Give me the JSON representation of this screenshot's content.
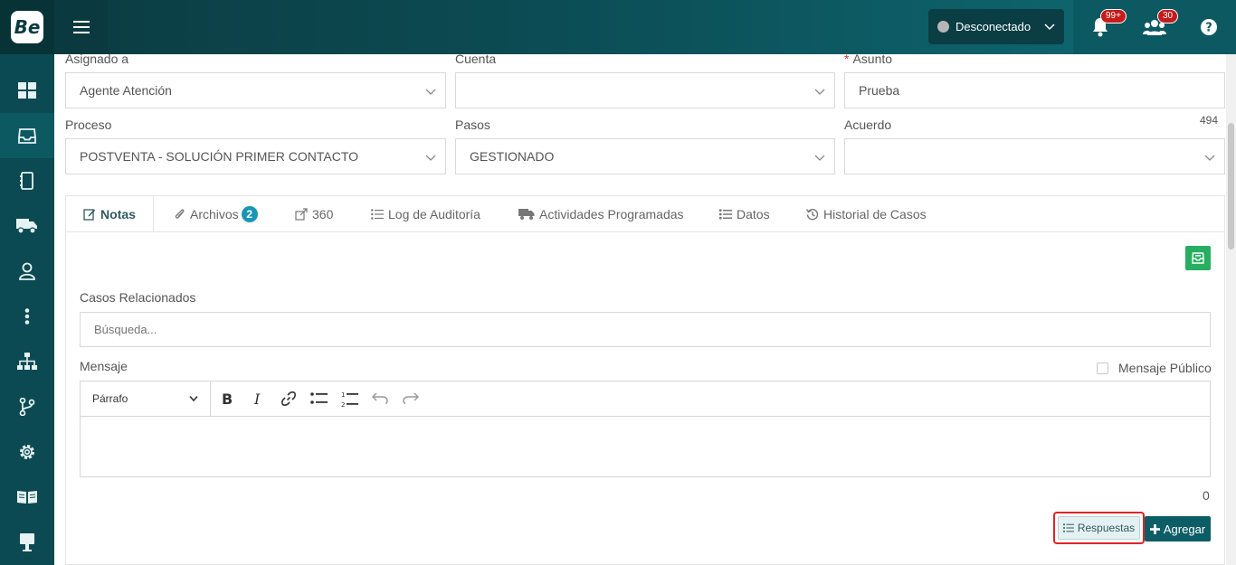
{
  "app": {
    "logo_text": "Be",
    "status": "Desconectado",
    "notifications_badge": "99+",
    "users_badge": "30"
  },
  "form": {
    "assigned": {
      "label": "Asignado a",
      "value": "Agente Atención"
    },
    "account": {
      "label": "Cuenta",
      "value": ""
    },
    "subject": {
      "required_mark": "*",
      "label": "Asunto",
      "value": "Prueba",
      "counter": "494"
    },
    "process": {
      "label": "Proceso",
      "value": "POSTVENTA - SOLUCIÓN PRIMER CONTACTO"
    },
    "steps": {
      "label": "Pasos",
      "value": "GESTIONADO"
    },
    "agreement": {
      "label": "Acuerdo",
      "value": ""
    }
  },
  "tabs": [
    {
      "label": "Notas"
    },
    {
      "label": "Archivos",
      "count": "2"
    },
    {
      "label": "360"
    },
    {
      "label": "Log de Auditoría"
    },
    {
      "label": "Actividades Programadas"
    },
    {
      "label": "Datos"
    },
    {
      "label": "Historial de Casos"
    }
  ],
  "notes": {
    "related_label": "Casos Relacionados",
    "search_placeholder": "Búsqueda...",
    "message_label": "Mensaje",
    "public_label": "Mensaje Público",
    "format_value": "Párrafo",
    "char_count": "0",
    "responses_label": "Respuestas",
    "add_label": "Agregar"
  },
  "colors": {
    "accent": "#0c5962",
    "badge": "#1a96b5",
    "green": "#27ae60",
    "alert": "#c61b1b"
  }
}
